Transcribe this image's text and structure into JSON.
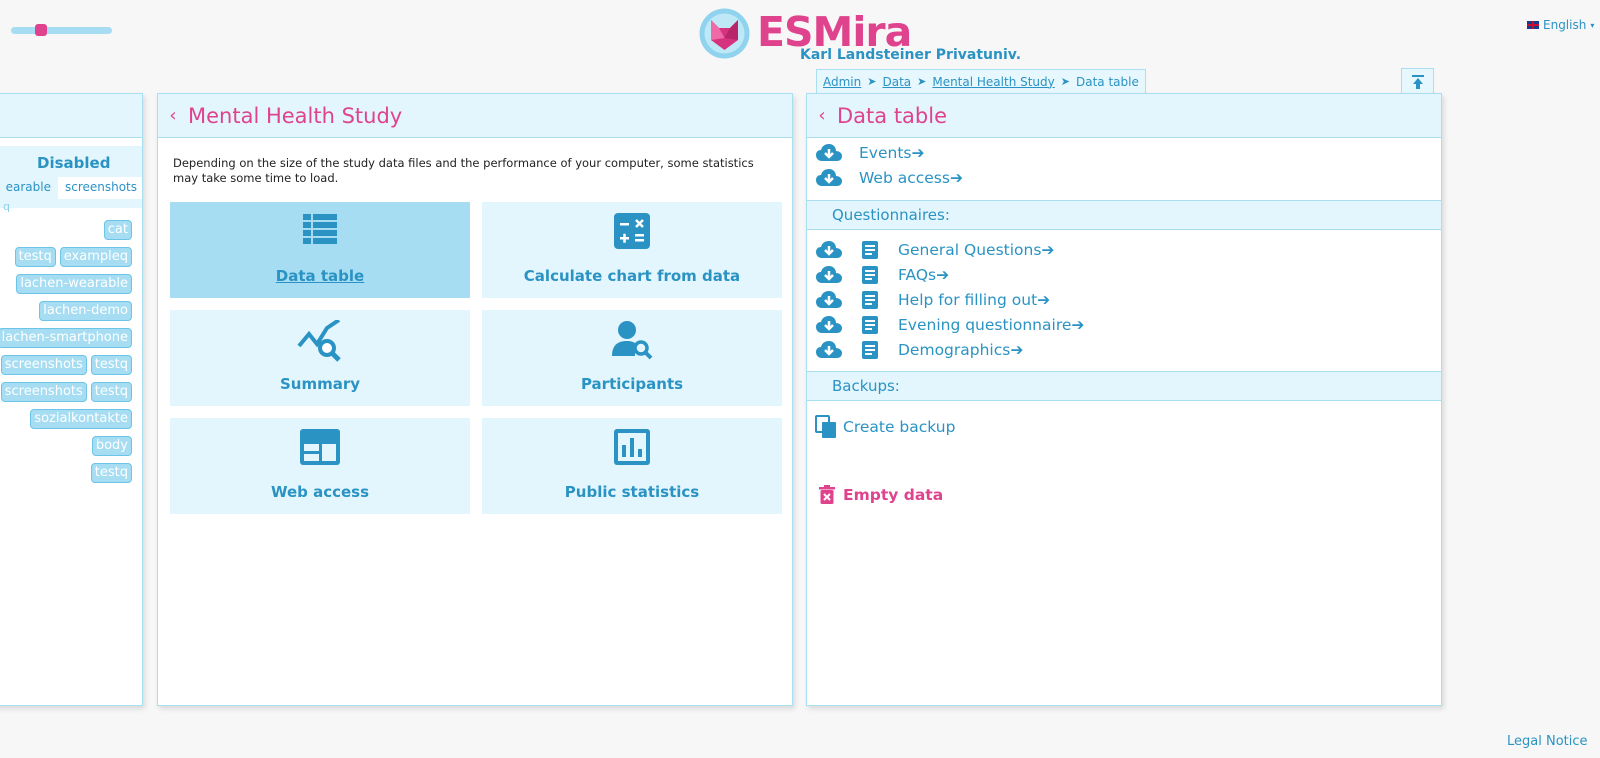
{
  "header": {
    "brand": "ESMira",
    "organization": "Karl Landsteiner Privatuniv.",
    "language": "English",
    "accent_color": "#e0438e",
    "primary_color": "#2a93c4"
  },
  "breadcrumb": {
    "items": [
      "Admin",
      "Data",
      "Mental Health Study"
    ],
    "current": "Data table",
    "separator": "➤"
  },
  "left_panel": {
    "status": "Disabled",
    "tabs": [
      "earable",
      "screenshots"
    ],
    "q_letter": "q",
    "tags": {
      "r0": [
        "cat"
      ],
      "r1": [
        "testq",
        "exampleq"
      ],
      "r2": [
        "lachen-wearable"
      ],
      "r3": [
        "lachen-demo"
      ],
      "r4": [
        "lachen-smartphone"
      ],
      "r5": [
        "screenshots",
        "testq"
      ],
      "r6": [
        "screenshots",
        "testq"
      ],
      "r7": [
        "sozialkontakte"
      ],
      "r8": [
        "body"
      ],
      "r9": [
        "testq"
      ]
    }
  },
  "middle_panel": {
    "back_icon": "‹",
    "title": "Mental Health Study",
    "hint": "Depending on the size of the study data files and the performance of your computer, some statistics may take some time to load.",
    "tiles": [
      {
        "label": "Data table",
        "icon": "table-icon",
        "active": true
      },
      {
        "label": "Calculate chart from data",
        "icon": "calculator-icon",
        "active": false
      },
      {
        "label": "Summary",
        "icon": "chart-search-icon",
        "active": false
      },
      {
        "label": "Participants",
        "icon": "person-search-icon",
        "active": false
      },
      {
        "label": "Web access",
        "icon": "web-window-icon",
        "active": false
      },
      {
        "label": "Public statistics",
        "icon": "bar-chart-icon",
        "active": false
      }
    ]
  },
  "right_panel": {
    "back_icon": "‹",
    "title": "Data table",
    "downloads": [
      {
        "label": "Events➔"
      },
      {
        "label": "Web access➔"
      }
    ],
    "questionnaires_heading": "Questionnaires:",
    "questionnaires": [
      {
        "label": "General Questions➔"
      },
      {
        "label": "FAQs➔"
      },
      {
        "label": "Help for filling out➔"
      },
      {
        "label": "Evening questionnaire➔"
      },
      {
        "label": "Demographics➔"
      }
    ],
    "backups_heading": "Backups:",
    "create_backup": "Create backup",
    "empty_data": "Empty data"
  },
  "footer": {
    "legal": "Legal Notice"
  }
}
